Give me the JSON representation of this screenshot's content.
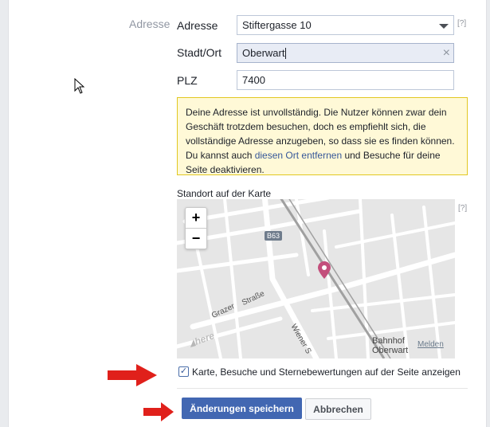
{
  "section_label": "Adresse",
  "address": {
    "label": "Adresse",
    "value": "Stiftergasse 10",
    "help": "[?]"
  },
  "city": {
    "label": "Stadt/Ort",
    "value": "Oberwart",
    "clear": "×"
  },
  "zip": {
    "label": "PLZ",
    "value": "7400"
  },
  "notice": {
    "text_before": "Deine Adresse ist unvollständig. Die Nutzer können zwar dein Geschäft trotzdem besuchen, doch es empfiehlt sich, die vollständige Adresse anzugeben, so dass sie es finden können. Du kannst auch ",
    "link": "diesen Ort entfernen",
    "text_after": " und Besuche für deine Seite deaktivieren."
  },
  "map": {
    "label": "Standort auf der Karte",
    "help": "[?]",
    "zoom_in": "+",
    "zoom_out": "−",
    "road_badge": "B63",
    "street_grazer": "Grazer",
    "street_strasse": "Straße",
    "street_wiener": "Wiener S",
    "station_line1": "Bahnhof",
    "station_line2": "Oberwart",
    "report": "Melden",
    "provider": "here"
  },
  "show_map": {
    "checked_mark": "✓",
    "label": "Karte, Besuche und Sternebewertungen auf der Seite anzeigen"
  },
  "buttons": {
    "save": "Änderungen speichern",
    "cancel": "Abbrechen"
  },
  "colors": {
    "primary": "#4267b2",
    "marker": "#c34f7c",
    "annotation_arrow": "#e0201b"
  }
}
